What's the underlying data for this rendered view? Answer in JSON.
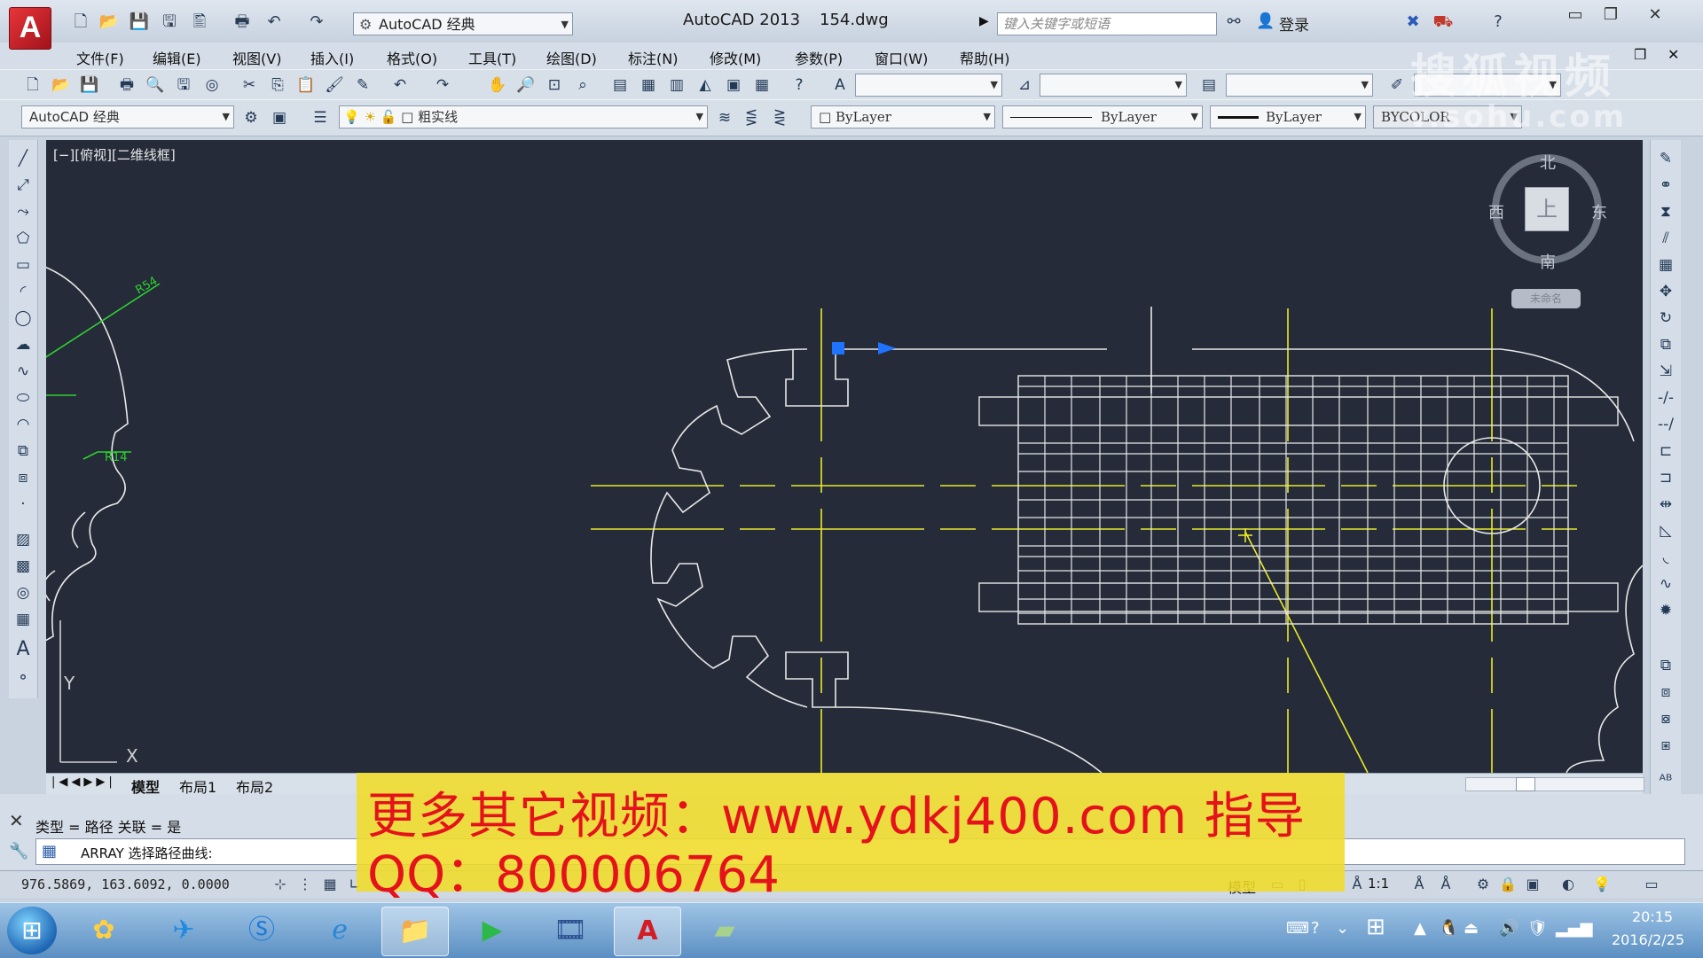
{
  "titlebar": {
    "workspace": "AutoCAD 经典",
    "app_name": "AutoCAD 2013",
    "file_name": "154.dwg",
    "search_placeholder": "键入关键字或短语",
    "login": "登录",
    "logo_letter": "A"
  },
  "menus": [
    "文件(F)",
    "编辑(E)",
    "视图(V)",
    "插入(I)",
    "格式(O)",
    "工具(T)",
    "绘图(D)",
    "标注(N)",
    "修改(M)",
    "参数(P)",
    "窗口(W)",
    "帮助(H)"
  ],
  "toolbar": {
    "workspace_combo": "AutoCAD 经典",
    "layer_combo": "粗实线",
    "color_combo": "ByLayer",
    "linetype_combo": "ByLayer",
    "lineweight_combo": "ByLayer",
    "plotstyle_combo": "BYCOLOR"
  },
  "viewport": {
    "label": "[−][俯视][二维线框]",
    "compass": {
      "north": "北",
      "south": "南",
      "east": "东",
      "west": "西",
      "top": "上"
    },
    "wcs": "未命名",
    "dimensions": [
      "R54",
      "R14"
    ],
    "ucs_y": "Y",
    "ucs_x": "X"
  },
  "layout_tabs": [
    "模型",
    "布局1",
    "布局2"
  ],
  "command": {
    "history": "类型 = 路径   关联 = 是",
    "prompt": "ARRAY 选择路径曲线:"
  },
  "status": {
    "coords": "976.5869,  163.6092,  0.0000",
    "model": "模型",
    "scale": "1:1"
  },
  "watermark": {
    "line1": "更多其它视频：www.ydkj400.com 指导",
    "line2": "QQ：800006764",
    "sohu": "搜狐视频",
    "sohu_url": "v.sohu.com"
  },
  "taskbar": {
    "time": "20:15",
    "date": "2016/2/25"
  },
  "colors": {
    "canvas": "#252b38",
    "centerline": "#e8ea2a",
    "geometry": "#e8e8e8",
    "dimension": "#2fd22f",
    "grip": "#1e73ff"
  }
}
